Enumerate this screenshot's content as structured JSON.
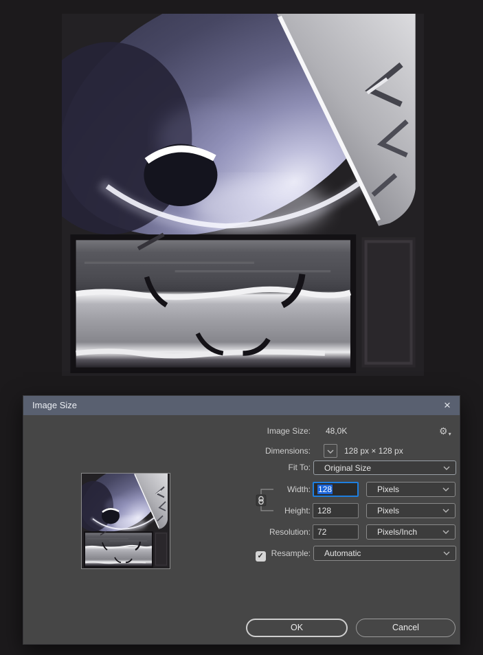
{
  "dialog": {
    "title": "Image Size",
    "close_glyph": "×",
    "image_size": {
      "label": "Image Size:",
      "value": "48,0K"
    },
    "dimensions": {
      "label": "Dimensions:",
      "value": "128 px  ×  128 px"
    },
    "fit_to": {
      "label": "Fit To:",
      "value": "Original Size"
    },
    "width": {
      "label": "Width:",
      "value": "128",
      "unit": "Pixels"
    },
    "height": {
      "label": "Height:",
      "value": "128",
      "unit": "Pixels"
    },
    "resolution": {
      "label": "Resolution:",
      "value": "72",
      "unit": "Pixels/Inch"
    },
    "resample": {
      "label": "Resample:",
      "value": "Automatic",
      "checked": true,
      "check_glyph": "✓"
    },
    "buttons": {
      "ok": "OK",
      "cancel": "Cancel"
    }
  },
  "icons": {
    "gear": "⚙",
    "gear_caret": "▾"
  },
  "colors": {
    "titlebar": "#596070",
    "dialog_bg": "#464646",
    "focus_border_blue": "#1e7fe0",
    "selection_blue": "#1b65d9",
    "page_bg": "#1c1a1c"
  }
}
